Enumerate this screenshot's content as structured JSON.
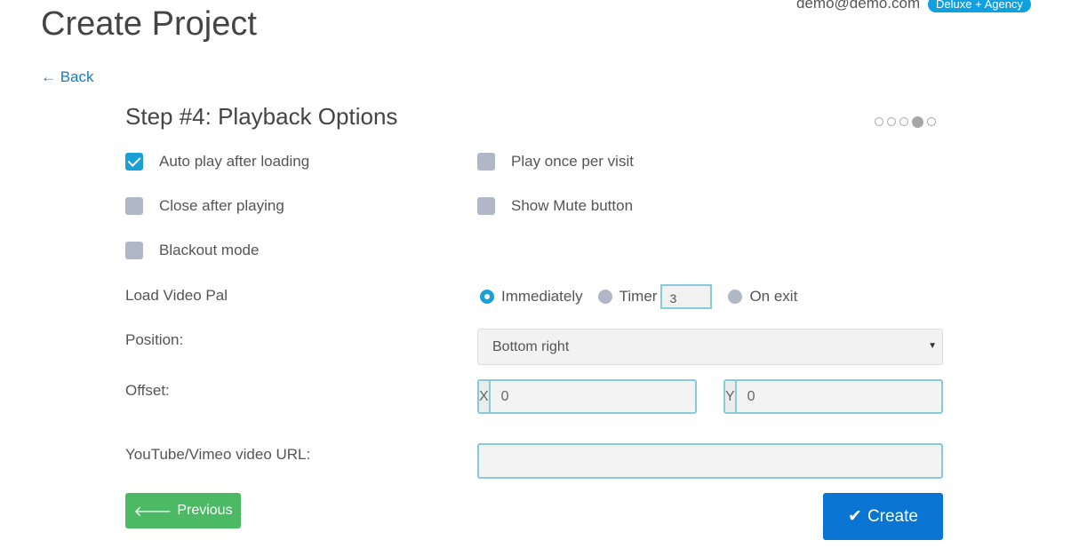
{
  "header": {
    "title": "Create Project",
    "user_email": "demo@demo.com",
    "plan_badge": "Deluxe + Agency",
    "back_label": "← Back"
  },
  "step": {
    "title": "Step #4: Playback Options",
    "total_steps": 5,
    "current_step": 4
  },
  "options": [
    {
      "label": "Auto play after loading",
      "checked": true
    },
    {
      "label": "Play once per visit",
      "checked": false
    },
    {
      "label": "Close after playing",
      "checked": false
    },
    {
      "label": "Show Mute button",
      "checked": false
    },
    {
      "label": "Blackout mode",
      "checked": false
    }
  ],
  "load": {
    "label": "Load Video Pal",
    "choices": [
      "Immediately",
      "Timer",
      "On exit"
    ],
    "selected": "Immediately",
    "timer_value": "3"
  },
  "position": {
    "label": "Position:",
    "value": "Bottom right"
  },
  "offset": {
    "label": "Offset:",
    "x_label": "X",
    "x_value": "0",
    "y_label": "Y",
    "y_value": "0"
  },
  "video": {
    "label": "YouTube/Vimeo video URL:",
    "value": ""
  },
  "buttons": {
    "previous": "Previous",
    "create": "Create"
  },
  "colors": {
    "accent": "#1a9fd9",
    "previous": "#4cba65",
    "create": "#0a74d2"
  }
}
